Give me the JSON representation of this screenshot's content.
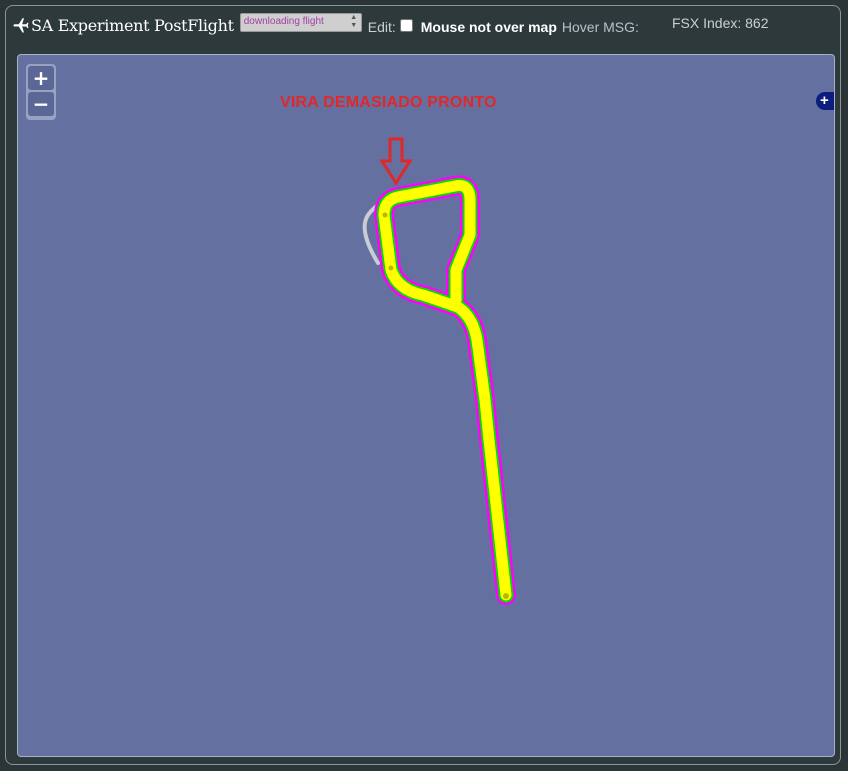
{
  "app": {
    "title": "SA Experiment PostFlight",
    "icon": "airplane-icon"
  },
  "flight_select": {
    "selected": "downloading flight"
  },
  "edit": {
    "label": "Edit:",
    "checked": false
  },
  "status": {
    "mouse": "Mouse not over map",
    "hover_label": "Hover MSG:",
    "fsx_index": "FSX Index: 862"
  },
  "map": {
    "zoom_in": "+",
    "zoom_out": "−",
    "expand": "+",
    "annotation": "VIRA DEMASIADO PRONTO",
    "colors": {
      "background": "#6470a0",
      "track_flown": "#ffff00",
      "track_outline_magenta": "#ff00ff",
      "track_outline_green": "#00e000",
      "reference_path": "#c8ccd6",
      "annotation": "#e0282b"
    }
  }
}
